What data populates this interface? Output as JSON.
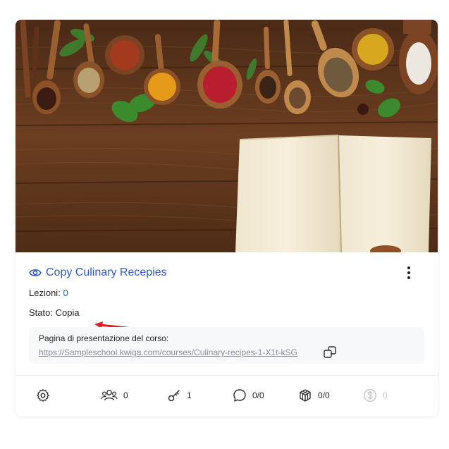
{
  "card": {
    "title": "Copy Culinary Recepies",
    "lessons_label": "Lezioni:",
    "lessons_value": "0",
    "status_label": "Stato:",
    "status_value": "Copia",
    "promo_label": "Pagina di presentazione del corso:",
    "promo_url": "https://Sampleschool.kwiga.com/courses/Culinary-recipes-1-X1t-kSG"
  },
  "stats": {
    "students": "0",
    "access_keys": "1",
    "comments": "0/0",
    "assignments": "0/0",
    "earnings": "0"
  },
  "icons": [
    "eye-icon",
    "more-vertical-icon",
    "copy-icon",
    "gear-icon",
    "users-icon",
    "key-icon",
    "comment-icon",
    "cube-icon",
    "dollar-icon",
    "red-arrow-annotation"
  ],
  "colors": {
    "accent": "#2a5bc9",
    "annotation": "#e01b1b",
    "muted": "#8a8f98"
  }
}
